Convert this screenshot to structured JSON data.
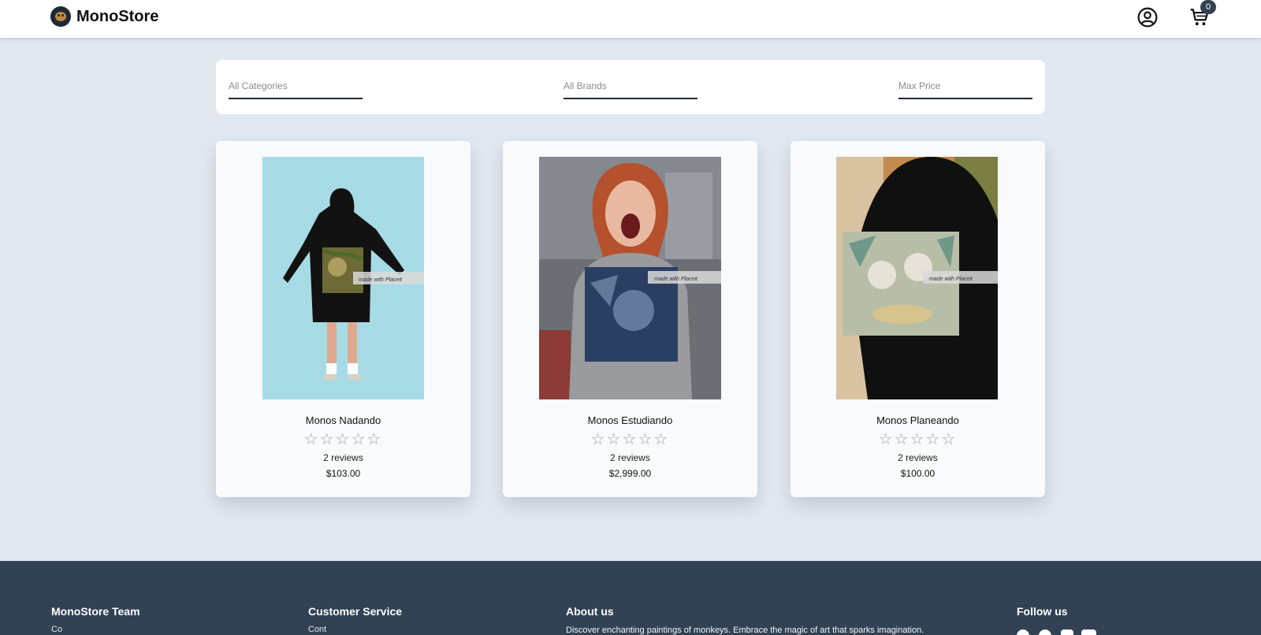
{
  "header": {
    "brand_name": "MonoStore",
    "cart_count": "0"
  },
  "filters": {
    "category_placeholder": "All Categories",
    "brand_placeholder": "All Brands",
    "price_placeholder": "Max Price"
  },
  "products": [
    {
      "name": "Monos Nadando",
      "stars": "☆☆☆☆☆",
      "reviews": "2 reviews",
      "price": "$103.00",
      "watermark": "made with Placeit"
    },
    {
      "name": "Monos Estudiando",
      "stars": "☆☆☆☆☆",
      "reviews": "2 reviews",
      "price": "$2,999.00",
      "watermark": "made with Placeit"
    },
    {
      "name": "Monos Planeando",
      "stars": "☆☆☆☆☆",
      "reviews": "2 reviews",
      "price": "$100.00",
      "watermark": "made with Placeit"
    }
  ],
  "footer": {
    "team_heading": "MonoStore Team",
    "service_heading": "Customer Service",
    "about_heading": "About us",
    "about_text": "Discover enchanting paintings of monkeys. Embrace the magic of art that sparks imagination.",
    "follow_heading": "Follow us",
    "team_link": "Co",
    "service_link": "Cont"
  },
  "colors": {
    "page_bg": "#e2e8f0",
    "footer_bg": "#334155",
    "badge_bg": "#334155",
    "star": "#9ca3af"
  },
  "icons": [
    "user-circle-icon",
    "cart-icon",
    "facebook-icon",
    "pinterest-icon",
    "instagram-icon",
    "youtube-icon"
  ]
}
